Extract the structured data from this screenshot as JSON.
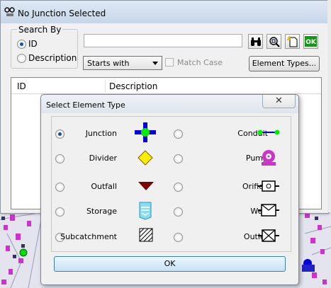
{
  "window": {
    "title": "No Junction Selected"
  },
  "search_by": {
    "legend": "Search By",
    "options": [
      {
        "label": "ID",
        "selected": true
      },
      {
        "label": "Description",
        "selected": false
      }
    ]
  },
  "search": {
    "value": ""
  },
  "toolbar": {
    "buttons": [
      {
        "name": "binoculars-icon"
      },
      {
        "name": "zoom-icon"
      },
      {
        "name": "new-document-icon"
      },
      {
        "name": "ok-icon",
        "label": "OK"
      }
    ]
  },
  "match": {
    "dropdown_value": "Starts with",
    "match_case_label": "Match Case",
    "match_case_checked": false
  },
  "element_types_button": "Element Types...",
  "results": {
    "columns": [
      "ID",
      "Description"
    ],
    "rows": []
  },
  "dialog": {
    "title": "Select Element Type",
    "close_label": "✕",
    "ok_label": "OK",
    "left_options": [
      {
        "label": "Junction",
        "icon": "junction-icon",
        "selected": true
      },
      {
        "label": "Divider",
        "icon": "divider-icon",
        "selected": false
      },
      {
        "label": "Outfall",
        "icon": "outfall-icon",
        "selected": false
      },
      {
        "label": "Storage",
        "icon": "storage-icon",
        "selected": false
      },
      {
        "label": "Subcatchment",
        "icon": "subcatchment-icon",
        "selected": false
      }
    ],
    "right_options": [
      {
        "label": "Conduit",
        "icon": "conduit-icon",
        "selected": false
      },
      {
        "label": "Pump",
        "icon": "pump-icon",
        "selected": false
      },
      {
        "label": "Orifice",
        "icon": "orifice-icon",
        "selected": false
      },
      {
        "label": "Weir",
        "icon": "weir-icon",
        "selected": false
      },
      {
        "label": "Outlet",
        "icon": "outlet-icon",
        "selected": false
      }
    ]
  },
  "colors": {
    "map_node": "#cc33cc",
    "junction_blue": "#0000dd",
    "junction_green": "#00ee00",
    "accent": "#3c7fb1"
  }
}
